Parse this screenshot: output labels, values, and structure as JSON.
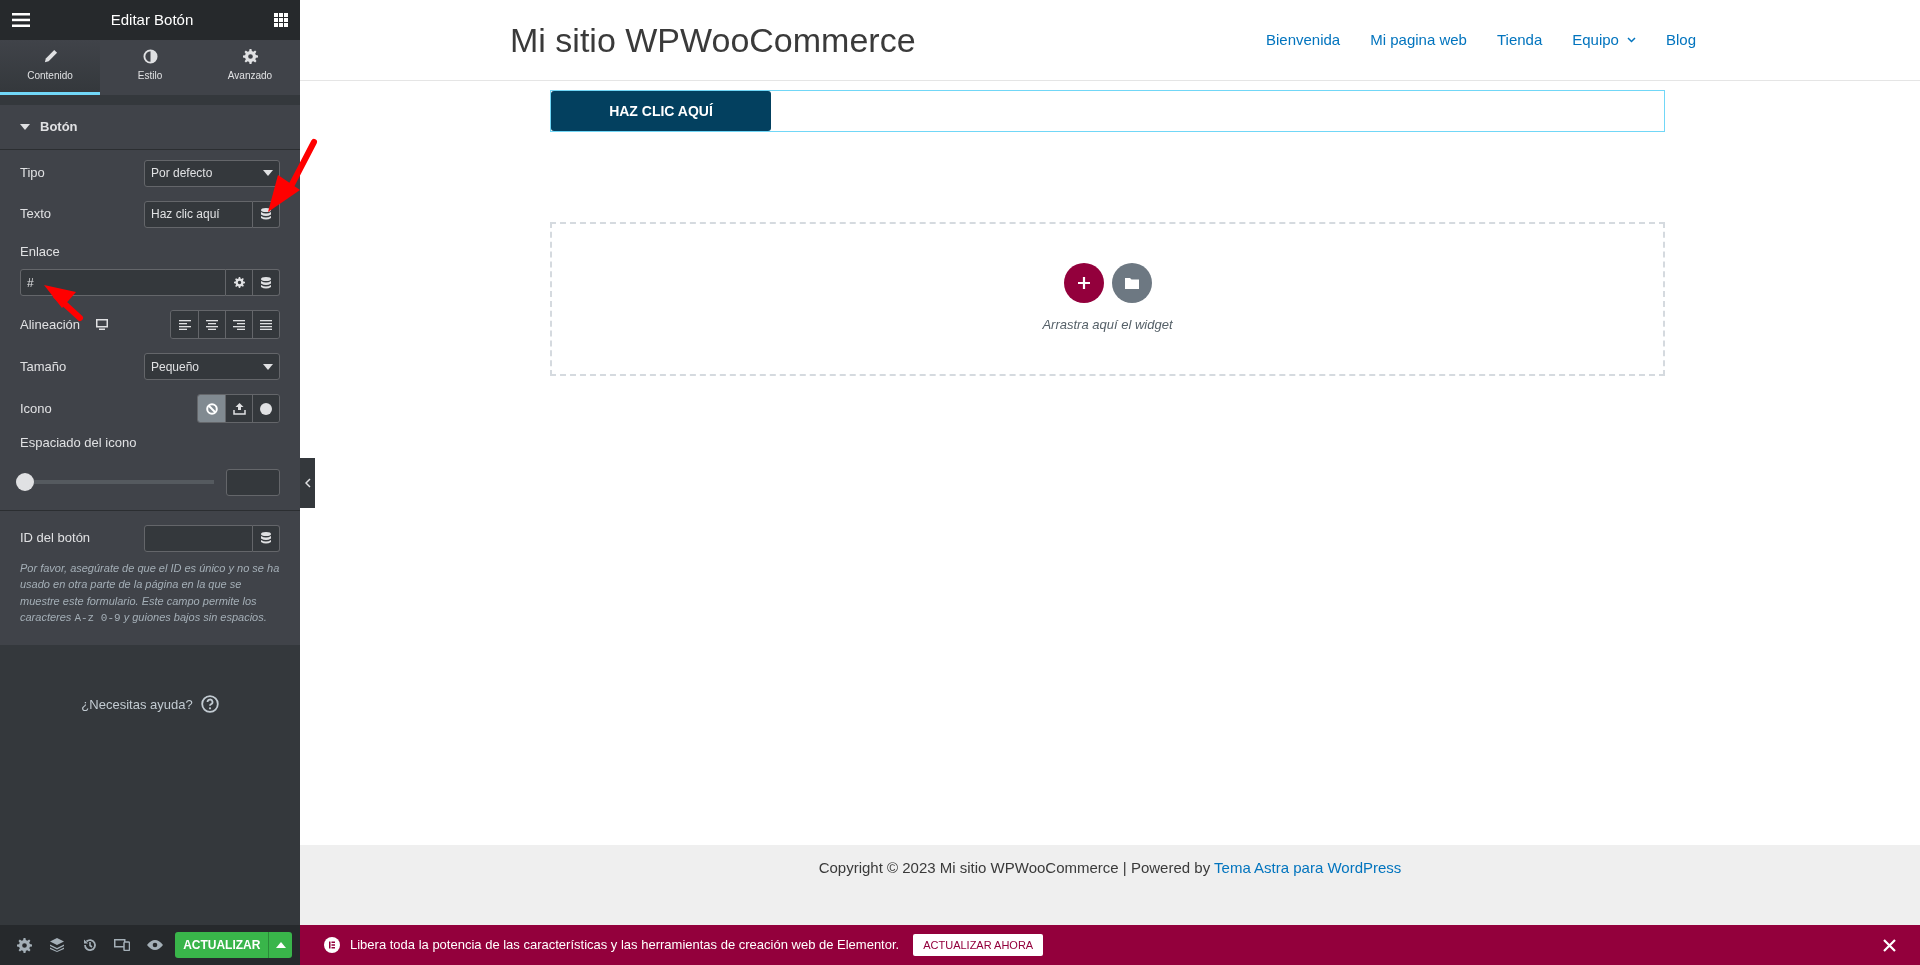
{
  "panel": {
    "title": "Editar Botón"
  },
  "tabs": [
    {
      "kind": "pencil",
      "label": "Contenido",
      "selected": true
    },
    {
      "kind": "contrast",
      "label": "Estilo",
      "selected": false
    },
    {
      "kind": "gear",
      "label": "Avanzado",
      "selected": false
    }
  ],
  "section": {
    "title": "Botón",
    "expanded": true
  },
  "controls": [
    {
      "kind": "select",
      "label": "Tipo",
      "value": "Por defecto"
    },
    {
      "kind": "text",
      "label": "Texto",
      "value": "Haz clic aquí"
    },
    {
      "kind": "url",
      "label": "Enlace",
      "value": "#"
    },
    {
      "kind": "alignment",
      "label": "Alineación",
      "options": [
        {
          "selected": false
        },
        {
          "selected": false
        },
        {
          "selected": false
        },
        {
          "selected": false
        }
      ]
    },
    {
      "kind": "select",
      "label": "Tamaño",
      "value": "Pequeño"
    },
    {
      "kind": "icon-choice",
      "label": "Icono",
      "options": [
        {
          "selected": true
        },
        {
          "selected": false
        },
        {
          "selected": false
        }
      ]
    },
    {
      "kind": "slider",
      "label": "Espaciado del icono",
      "level": 0
    },
    {
      "kind": "divider"
    },
    {
      "kind": "text",
      "label": "ID del botón"
    },
    {
      "kind": "help",
      "before": "Por favor, asegúrate de que el ID es único y no se ha usado en otra parte de la página en la que se muestre este formulario. Este campo permite los caracteres ",
      "code": "A-z 0-9",
      "after": " y guiones bajos sin espacios."
    }
  ],
  "help_link": "¿Necesitas ayuda?",
  "update_button": "ACTUALIZAR",
  "site": {
    "title": "Mi sitio WPWooCommerce",
    "nav": [
      {
        "label": "Bienvenida",
        "dropdown": false
      },
      {
        "label": "Mi pagina web",
        "dropdown": false
      },
      {
        "label": "Tienda",
        "dropdown": false
      },
      {
        "label": "Equipo",
        "dropdown": true
      },
      {
        "label": "Blog",
        "dropdown": false
      }
    ],
    "button": "HAZ CLIC AQUÍ",
    "dropzone": "Arrastra aquí el widget",
    "copyright": "Copyright © 2023 Mi sitio WPWooCommerce | Powered by ",
    "copyright_link": "Tema Astra para WordPress"
  },
  "notice": {
    "text": "Libera toda la potencia de las características y las herramientas de creación web de Elementor.",
    "button": "ACTUALIZAR AHORA"
  }
}
